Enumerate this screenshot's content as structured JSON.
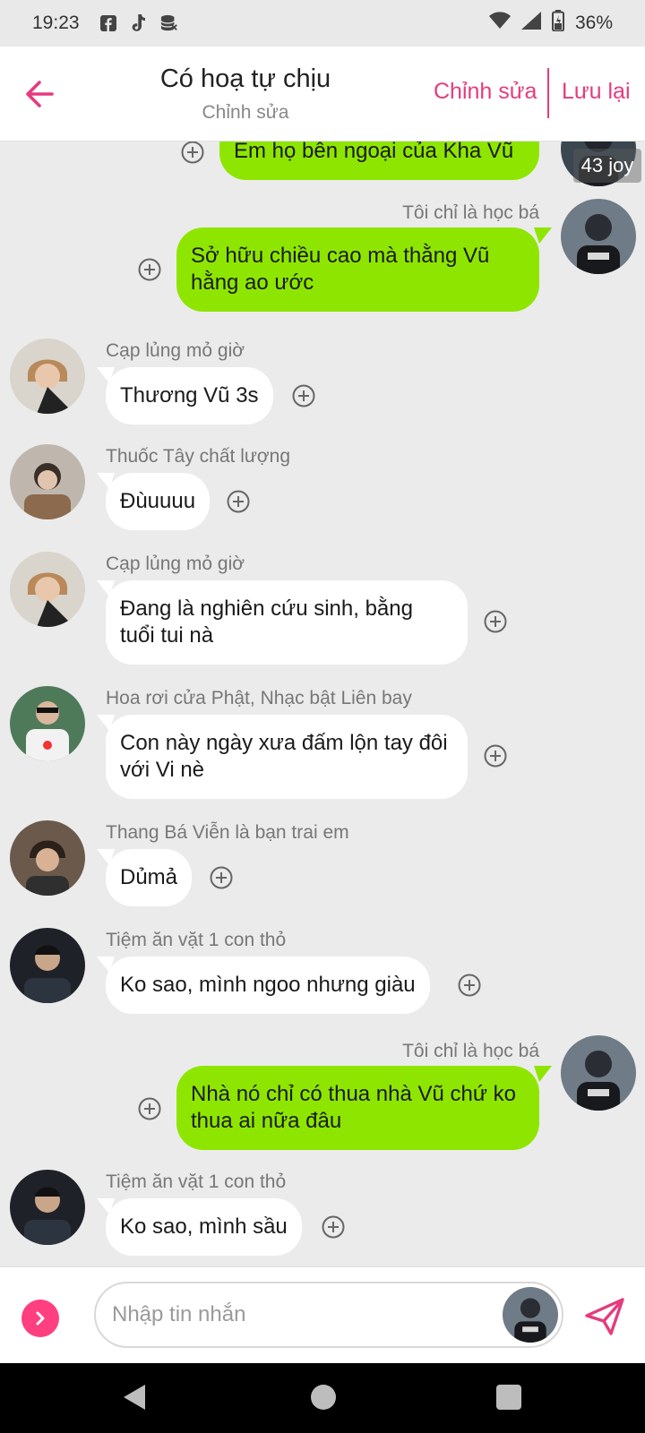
{
  "status_bar": {
    "time": "19:23",
    "battery": "36%"
  },
  "header": {
    "title": "Có hoạ tự chịu",
    "subtitle": "Chỉnh sửa",
    "edit_label": "Chỉnh sửa",
    "save_label": "Lưu lại"
  },
  "colors": {
    "accent": "#e53b7e",
    "outgoing_bubble": "#8ee600",
    "incoming_bubble": "#ffffff",
    "background": "#ebebeb"
  },
  "messages": [
    {
      "direction": "out",
      "sender": "",
      "text": "Em họ bên ngoại của Kha Vũ",
      "badge": "43 joy"
    },
    {
      "direction": "out",
      "sender": "Tôi chỉ là học bá",
      "text": "Sở hữu chiều cao mà thằng Vũ hằng ao ước"
    },
    {
      "direction": "in",
      "sender": "Cạp lủng mỏ giờ",
      "text": "Thương Vũ 3s"
    },
    {
      "direction": "in",
      "sender": "Thuốc Tây chất lượng",
      "text": "Đùuuuu"
    },
    {
      "direction": "in",
      "sender": "Cạp lủng mỏ giờ",
      "text": "Đang là nghiên cứu sinh, bằng tuổi tui nà"
    },
    {
      "direction": "in",
      "sender": "Hoa rơi cửa Phật, Nhạc bật Liên bay",
      "text": "Con này ngày xưa đấm lộn tay đôi với Vi nè"
    },
    {
      "direction": "in",
      "sender": "Thang Bá Viễn là bạn trai em",
      "text": "Dủmả"
    },
    {
      "direction": "in",
      "sender": "Tiệm ăn vặt 1 con thỏ",
      "text": "Ko sao, mình ngoo nhưng giàu"
    },
    {
      "direction": "out",
      "sender": "Tôi chỉ là học bá",
      "text": "Nhà nó chỉ có thua nhà Vũ chứ ko thua ai nữa đâu"
    },
    {
      "direction": "in",
      "sender": "Tiệm ăn vặt 1 con thỏ",
      "text": "Ko sao, mình sầu"
    }
  ],
  "composer": {
    "placeholder": "Nhập tin nhắn"
  },
  "icons": {
    "back": "arrow-left-icon",
    "react": "plus-circle-icon",
    "send": "paper-plane-icon",
    "expand": "chevron-right-icon",
    "wifi": "wifi-icon",
    "signal": "signal-icon",
    "battery": "battery-charging-icon",
    "facebook": "facebook-icon",
    "tiktok": "tiktok-icon",
    "storage": "database-icon"
  }
}
